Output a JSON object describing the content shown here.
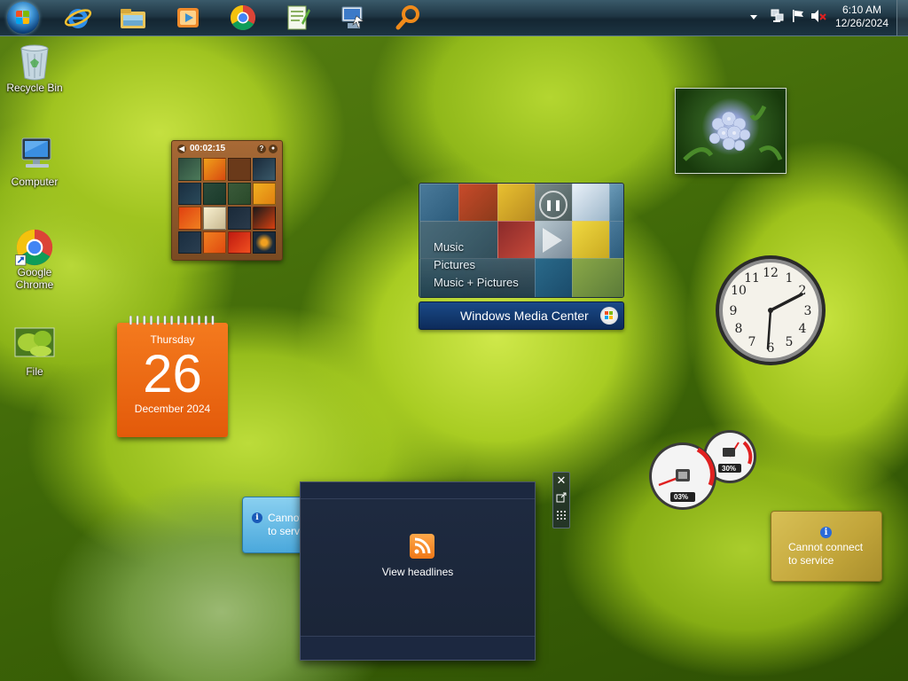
{
  "taskbar": {
    "pinned": [
      {
        "name": "internet-explorer-icon"
      },
      {
        "name": "windows-explorer-icon"
      },
      {
        "name": "media-player-icon"
      },
      {
        "name": "google-chrome-icon"
      },
      {
        "name": "notepad-plus-plus-icon"
      },
      {
        "name": "remote-desktop-icon"
      },
      {
        "name": "search-icon"
      }
    ],
    "clock": {
      "time": "6:10 AM",
      "date": "12/26/2024"
    }
  },
  "desktop_icons": [
    {
      "label": "Recycle Bin",
      "icon": "recycle-bin-icon"
    },
    {
      "label": "Computer",
      "icon": "computer-icon"
    },
    {
      "label": "Google Chrome",
      "icon": "google-chrome-icon"
    },
    {
      "label": "File",
      "icon": "file-icon"
    }
  ],
  "gadgets": {
    "puzzle": {
      "timer": "00:02:15"
    },
    "calendar": {
      "weekday": "Thursday",
      "day": "26",
      "month_year": "December 2024"
    },
    "media_center": {
      "items": [
        "Music",
        "Pictures",
        "Music + Pictures"
      ],
      "brand": "Windows Media Center"
    },
    "cpu_meter": {
      "cpu": "03%",
      "memory": "30%"
    },
    "weather": {
      "line1": "Cannot connect",
      "line2": "to service"
    },
    "stocks": {
      "line1": "Cannot",
      "line2": "to serv"
    },
    "feed_headlines": {
      "link": "View headlines"
    }
  },
  "colors": {
    "calendar_orange": "#ee6a12",
    "taskbar": "#1f3644",
    "media_center_brand": "#1a4a88",
    "weather_gold": "#c2a53a"
  }
}
